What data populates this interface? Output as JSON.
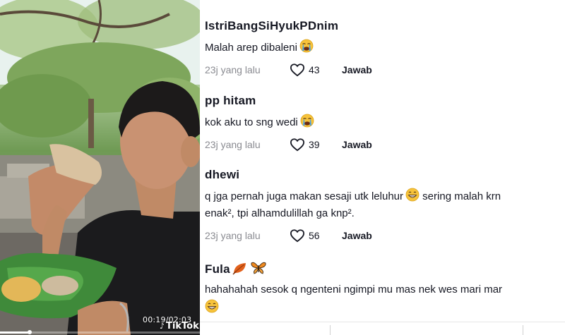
{
  "video": {
    "time": "00:19/02:03",
    "brand": "TikTok",
    "progress": 0.15
  },
  "comments": [
    {
      "username": "IstriBangSiHyukPDnim",
      "text": "Malah arep dibaleni",
      "emoji": "crying-face",
      "ago": "23j yang lalu",
      "likes": "43",
      "reply": "Jawab"
    },
    {
      "username": "pp hitam",
      "text": "kok aku to sng wedi",
      "emoji": "crying-face",
      "ago": "23j yang lalu",
      "likes": "39",
      "reply": "Jawab"
    },
    {
      "username": "dhewi",
      "text_line1_a": "q jga pernah juga makan sesaji utk leluhur",
      "text_line1_b": " sering malah krn",
      "text_line2": "enak², tpi alhamdulillah ga knp².",
      "emoji": "grinning-face",
      "ago": "23j yang lalu",
      "likes": "56",
      "reply": "Jawab"
    },
    {
      "username": "Fula",
      "username_emojis": [
        "leaf",
        "butterfly"
      ],
      "text": "hahahahah sesok q ngenteni ngimpi mu mas nek wes mari mar",
      "emoji": "grinning-face"
    }
  ],
  "colors": {
    "text": "#161823",
    "muted": "#8a8b91",
    "emoji_yellow": "#f7c33b",
    "emoji_blue": "#4aa3e8",
    "butterfly": "#f08a1f"
  }
}
